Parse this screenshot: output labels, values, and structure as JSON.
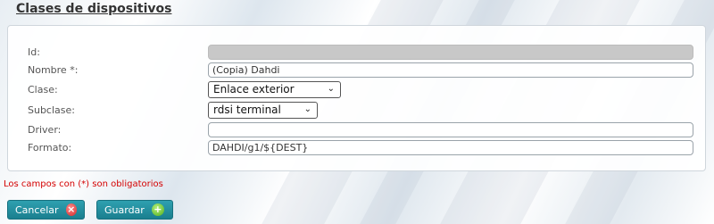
{
  "page": {
    "title": "Clases de dispositivos"
  },
  "form": {
    "id": {
      "label": "Id:",
      "value": ""
    },
    "nombre": {
      "label": "Nombre *:",
      "value": "(Copia) Dahdi"
    },
    "clase": {
      "label": "Clase:",
      "selected": "Enlace exterior"
    },
    "subclase": {
      "label": "Subclase:",
      "selected": "rdsi terminal"
    },
    "driver": {
      "label": "Driver:",
      "value": ""
    },
    "formato": {
      "label": "Formato:",
      "value": "DAHDI/g1/${DEST}"
    }
  },
  "required_note": "Los campos con (*) son obligatorios",
  "buttons": {
    "cancel": {
      "label": "Cancelar",
      "icon": "x-circle-icon",
      "color": "#d42a2a"
    },
    "save": {
      "label": "Guardar",
      "icon": "plus-circle-icon",
      "color": "#4fae1c"
    }
  },
  "colors": {
    "button_bg": "#1f8a9a",
    "required_text": "#d40000"
  }
}
